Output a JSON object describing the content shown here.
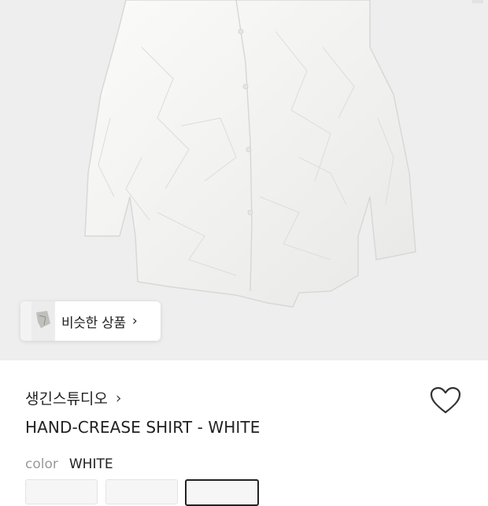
{
  "similar_products": {
    "label": "비슷한 상품",
    "chevron": "›"
  },
  "product": {
    "brand": "생긴스튜디오",
    "brand_chevron": "›",
    "title": "HAND-CREASE SHIRT - WHITE",
    "color_label": "color",
    "color_value": "WHITE"
  },
  "icons": {
    "wishlist": "heart-outline-icon",
    "chevron": "chevron-right-icon"
  },
  "colors": {
    "background": "#eeeeee",
    "shirt": "#f7f7f5",
    "text": "#222222",
    "muted": "#999999"
  },
  "swatches": [
    {
      "name": "swatch-1",
      "selected": false
    },
    {
      "name": "swatch-2",
      "selected": false
    },
    {
      "name": "swatch-3",
      "selected": true
    }
  ]
}
